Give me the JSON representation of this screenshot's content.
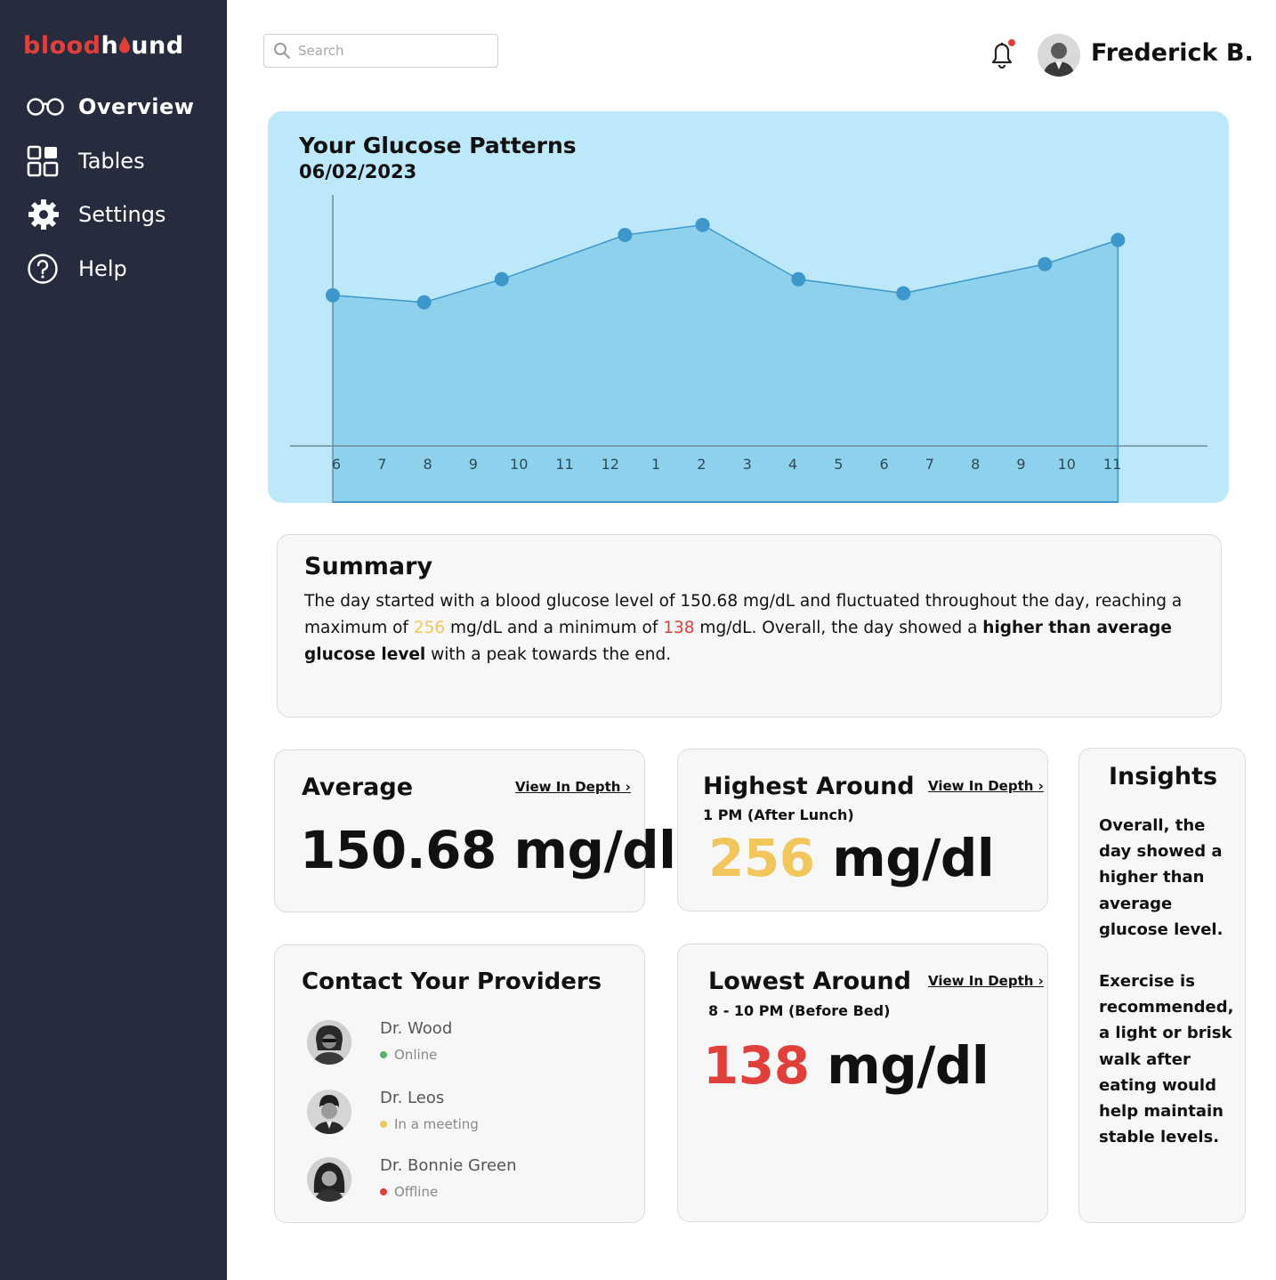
{
  "brand": {
    "part1": "blood",
    "part2": "h",
    "part3": "und",
    "red": "#e1403a"
  },
  "sidebar": {
    "items": [
      {
        "label": "Overview",
        "icon": "glasses-icon",
        "active": true
      },
      {
        "label": "Tables",
        "icon": "grid-icon",
        "active": false
      },
      {
        "label": "Settings",
        "icon": "gear-icon",
        "active": false
      },
      {
        "label": "Help",
        "icon": "help-icon",
        "active": false
      }
    ]
  },
  "header": {
    "search_placeholder": "Search",
    "user_name": "Frederick B."
  },
  "chart": {
    "title": "Your Glucose Patterns",
    "date": "06/02/2023"
  },
  "chart_data": {
    "type": "area",
    "title": "Your Glucose Patterns",
    "subtitle": "06/02/2023",
    "x_ticks": [
      "6",
      "7",
      "8",
      "9",
      "10",
      "11",
      "12",
      "1",
      "2",
      "3",
      "4",
      "5",
      "6",
      "7",
      "8",
      "9",
      "10",
      "11"
    ],
    "points": [
      {
        "x": 0,
        "y": 150
      },
      {
        "x": 2,
        "y": 143
      },
      {
        "x": 3.7,
        "y": 166
      },
      {
        "x": 6.4,
        "y": 210
      },
      {
        "x": 8.1,
        "y": 220
      },
      {
        "x": 10.2,
        "y": 166
      },
      {
        "x": 12.5,
        "y": 152
      },
      {
        "x": 15.6,
        "y": 181
      },
      {
        "x": 17.2,
        "y": 205
      }
    ],
    "ylim": [
      0,
      280
    ],
    "grid": false,
    "colors": {
      "fill": "#8dd1ec",
      "line": "#3d97cb",
      "point": "#3d97cb",
      "background": "#bce8f9"
    }
  },
  "summary": {
    "title": "Summary",
    "t1": "The day started with a blood glucose level of 150.68 mg/dL and fluctuated throughout the day, reaching a maximum of ",
    "max": "256",
    "t2": " mg/dL and a minimum of ",
    "min": "138",
    "t3": " mg/dL. Overall, the day showed a ",
    "bold": "higher than average glucose level",
    "t4": " with a peak towards the end."
  },
  "stats": {
    "average": {
      "title": "Average",
      "link": "View In Depth ›",
      "value": "150.68 mg/dl"
    },
    "highest": {
      "title": "Highest Around",
      "sub": "1 PM (After Lunch)",
      "link": "View In Depth ›",
      "num": "256",
      "unit": " mg/dl"
    },
    "lowest": {
      "title": "Lowest Around",
      "sub": "8 - 10 PM (Before Bed)",
      "link": "View In Depth ›",
      "num": "138",
      "unit": " mg/dl"
    }
  },
  "providers": {
    "title": "Contact Your Providers",
    "list": [
      {
        "name": "Dr. Wood",
        "status": "Online",
        "status_color": "#59b36b"
      },
      {
        "name": "Dr. Leos",
        "status": "In a meeting",
        "status_color": "#f1c75d"
      },
      {
        "name": "Dr. Bonnie Green",
        "status": "Offline",
        "status_color": "#e1403a"
      }
    ]
  },
  "insights": {
    "title": "Insights",
    "p1a": "Overall, the day showed a ",
    "p1b": "higher than average glucose level.",
    "p2": "Exercise is recommended, a light or brisk walk after eating would help maintain stable levels."
  }
}
